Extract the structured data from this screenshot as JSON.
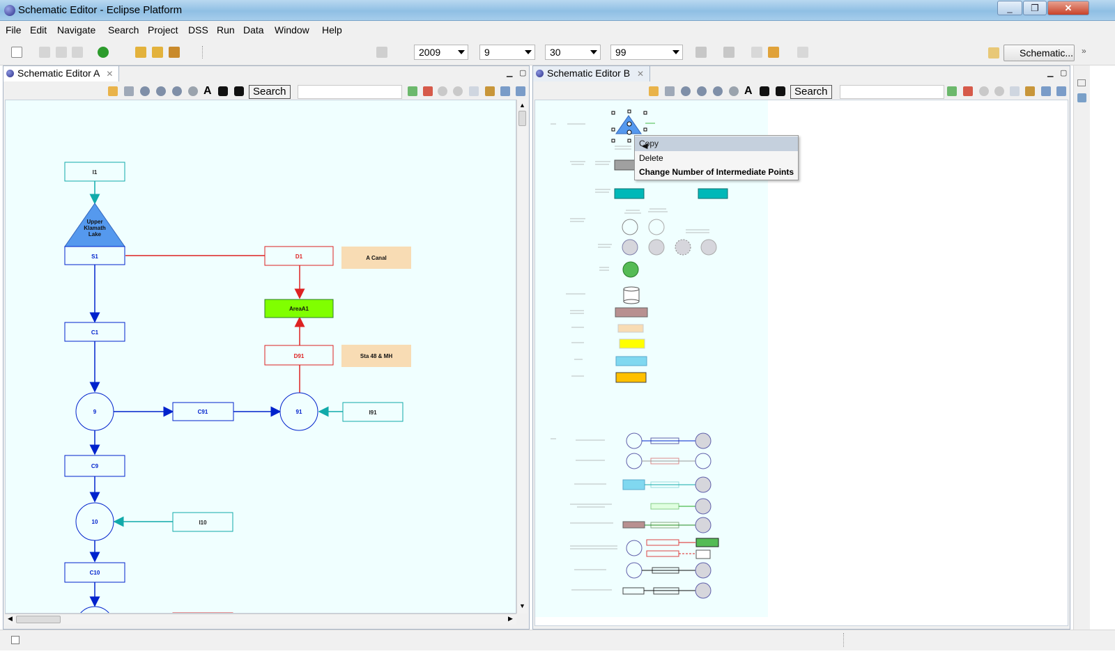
{
  "window": {
    "title": "Schematic Editor - Eclipse Platform",
    "controls": [
      "_",
      "❐",
      "✕"
    ]
  },
  "menu": [
    "File",
    "Edit",
    "Navigate",
    "Search",
    "Project",
    "DSS",
    "Run",
    "Data",
    "Window",
    "Help"
  ],
  "toolbar": {
    "year": "2009",
    "month": "9",
    "day": "30",
    "number": "99",
    "perspective": "Schematic..."
  },
  "editor_a": {
    "tab": "Schematic Editor A",
    "search_label": "Search",
    "nodes": {
      "i1": "I1",
      "lake": [
        "Upper",
        "Klamath",
        "Lake"
      ],
      "s1": "S1",
      "d1": "D1",
      "a_canal": "A Canal",
      "area_a1": "AreaA1",
      "d91": "D91",
      "sta48": "Sta 48 & MH",
      "c1": "C1",
      "n9": "9",
      "c91": "C91",
      "n91": "91",
      "i91": "I91",
      "c9": "C9",
      "n10": "10",
      "i10": "I10",
      "c10": "C10"
    }
  },
  "editor_b": {
    "tab": "Schematic Editor B",
    "search_label": "Search"
  },
  "context_menu": [
    "Copy",
    "Delete",
    "Change Number of Intermediate Points"
  ],
  "colors": {
    "canvas": "#f0ffff",
    "flow": "#0022cc",
    "diversion": "#dd2222",
    "inflow": "#11aaaa",
    "area": "#80ff00",
    "label_box": "#f8dcb4",
    "lake": "#5599ee"
  }
}
